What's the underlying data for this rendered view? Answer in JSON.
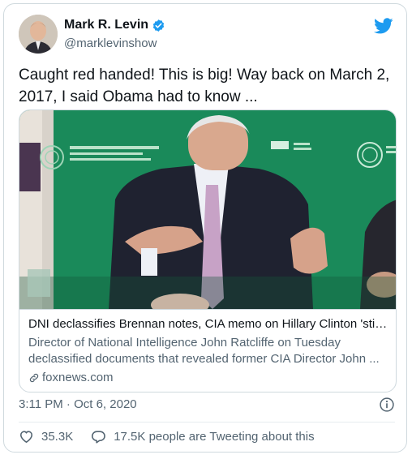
{
  "author": {
    "display_name": "Mark R. Levin",
    "handle": "@marklevinshow"
  },
  "tweet": {
    "text": "Caught red handed!  This is big!  Way back on March 2, 2017, I said Obama had to know ...",
    "timestamp": "3:11 PM · Oct 6, 2020"
  },
  "link_card": {
    "title": "DNI declassifies Brennan notes, CIA memo on Hillary Clinton 'stirr...",
    "description": "Director of National Intelligence John Ratcliffe on Tuesday declassified documents that revealed former CIA Director John ...",
    "domain": "foxnews.com"
  },
  "engagement": {
    "likes": "35.3K",
    "conversation": "17.5K people are Tweeting about this"
  },
  "colors": {
    "brand": "#1d9bf0",
    "text_primary": "#0f1419",
    "text_secondary": "#536471",
    "border": "#cfd9de",
    "backdrop_green": "#1a8a5a"
  },
  "icons": {
    "verified": "verified-badge-icon",
    "twitter": "twitter-bird-icon",
    "link": "link-icon",
    "info": "info-icon",
    "like": "heart-icon",
    "reply": "speech-bubble-icon"
  }
}
